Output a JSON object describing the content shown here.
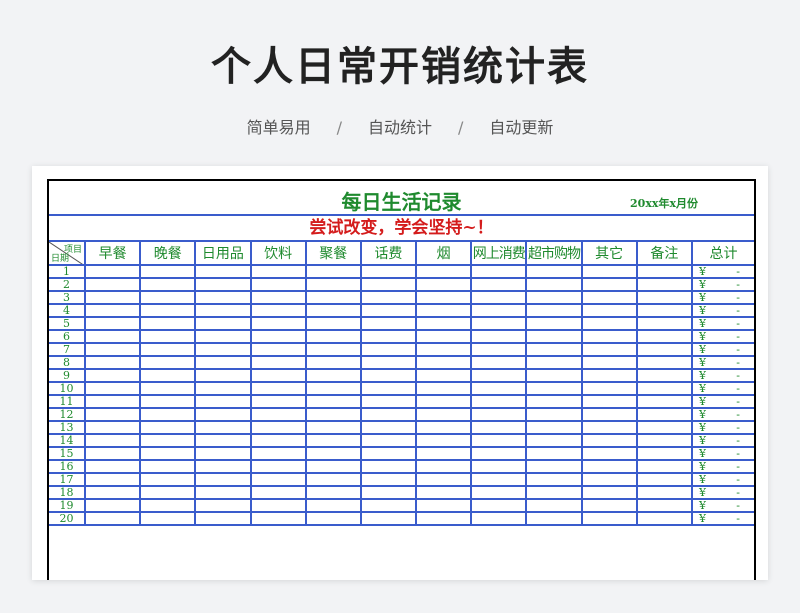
{
  "header": {
    "title": "个人日常开销统计表",
    "features": [
      "简单易用",
      "自动统计",
      "自动更新"
    ],
    "separator": "/"
  },
  "sheet": {
    "title": "每日生活记录",
    "month": "20xx年x月份",
    "slogan": "尝试改变，学会坚持~！",
    "corner_item": "项目",
    "corner_date": "日期",
    "columns": [
      "早餐",
      "晚餐",
      "日用品",
      "饮料",
      "聚餐",
      "话费",
      "烟",
      "网上消费",
      "超市购物",
      "其它",
      "备注",
      "总计"
    ],
    "rows": [
      "1",
      "2",
      "3",
      "4",
      "5",
      "6",
      "7",
      "8",
      "9",
      "10",
      "11",
      "12",
      "13",
      "14",
      "15",
      "16",
      "17",
      "18",
      "19",
      "20"
    ],
    "currency": "¥",
    "empty_total": "-"
  },
  "colors": {
    "grid_blue": "#3a5ccc",
    "green_text": "#1f8a2e",
    "red_text": "#d41c1c"
  }
}
